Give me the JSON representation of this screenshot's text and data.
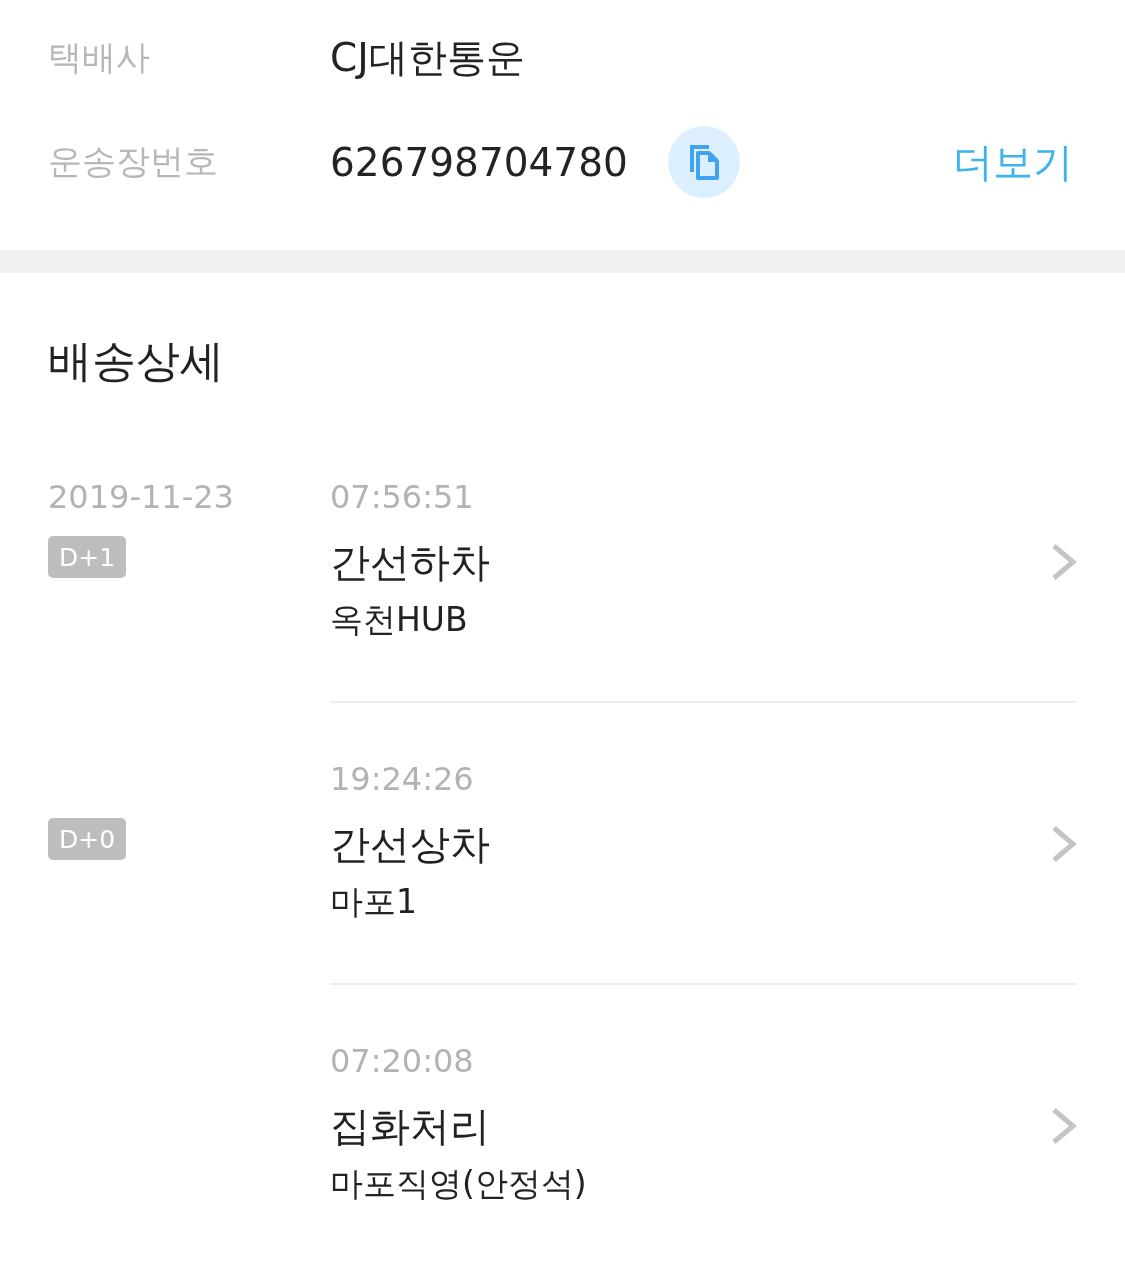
{
  "shipment": {
    "rows": [
      {
        "label": "택배사",
        "value": "CJ대한통운"
      },
      {
        "label": "운송장번호",
        "value": "626798704780",
        "copyable": true
      }
    ],
    "more_link": "더보기"
  },
  "details": {
    "title": "배송상세",
    "events": [
      {
        "date": "2019-11-23",
        "badge": "D+1",
        "time": "07:56:51",
        "status": "간선하차",
        "location": "옥천HUB"
      },
      {
        "badge": "D+0",
        "time": "19:24:26",
        "status": "간선상차",
        "location": "마포1"
      },
      {
        "time": "07:20:08",
        "status": "집화처리",
        "location": "마포직영(안정석)"
      }
    ]
  }
}
